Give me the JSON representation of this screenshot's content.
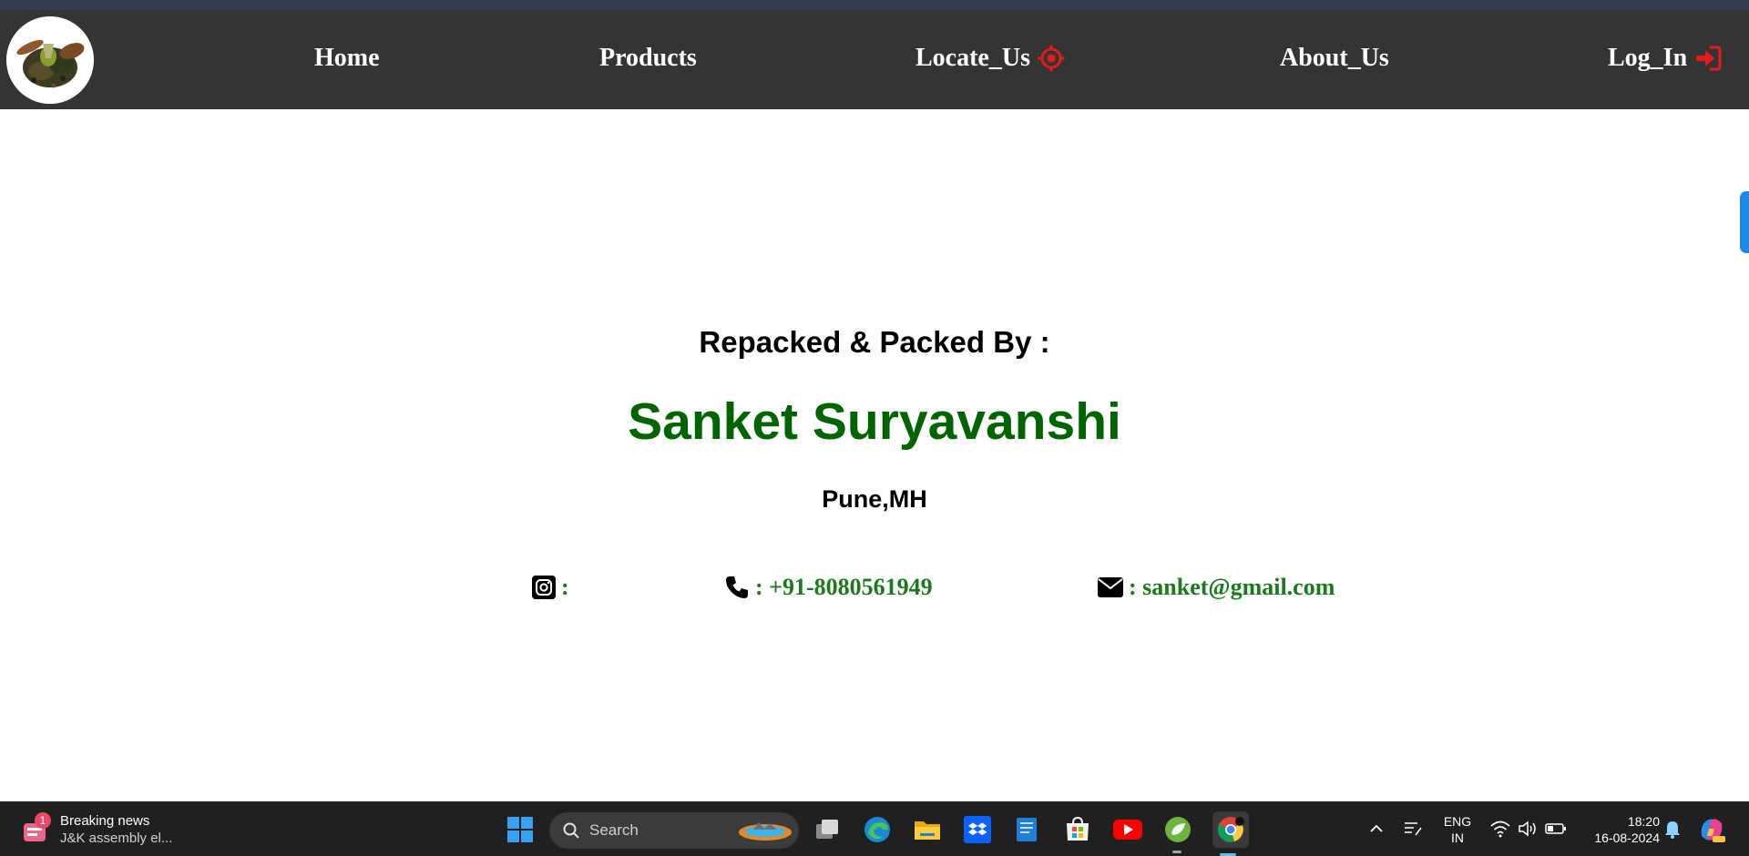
{
  "nav": {
    "items": [
      {
        "label": "Home"
      },
      {
        "label": "Products"
      },
      {
        "label": "Locate_Us",
        "icon": "crosshair-icon"
      },
      {
        "label": "About_Us"
      },
      {
        "label": "Log_In",
        "icon": "sign-in-icon"
      }
    ],
    "icon_color": "#e31b1b",
    "background": "#343434"
  },
  "main": {
    "packed_by_label": "Repacked & Packed By :",
    "name": "Sanket Suryavanshi",
    "name_color": "#006400",
    "location": "Pune,MH",
    "contacts": [
      {
        "icon": "instagram-icon",
        "text": ":"
      },
      {
        "icon": "phone-icon",
        "text": ": +91-8080561949"
      },
      {
        "icon": "envelope-icon",
        "text": ": sanket@gmail.com"
      }
    ],
    "contact_color": "#1b7a1b"
  },
  "taskbar": {
    "news_badge": "1",
    "news_title": "Breaking news",
    "news_subtitle": "J&K assembly el...",
    "search_placeholder": "Search",
    "apps": [
      "windows-start-icon",
      "task-view-icon",
      "edge-icon",
      "file-explorer-icon",
      "dropbox-icon",
      "notepad-icon",
      "microsoft-store-icon",
      "youtube-icon",
      "spring-icon",
      "chrome-icon"
    ],
    "tray": {
      "language_line1": "ENG",
      "language_line2": "IN",
      "time": "18:20",
      "date": "16-08-2024"
    }
  }
}
